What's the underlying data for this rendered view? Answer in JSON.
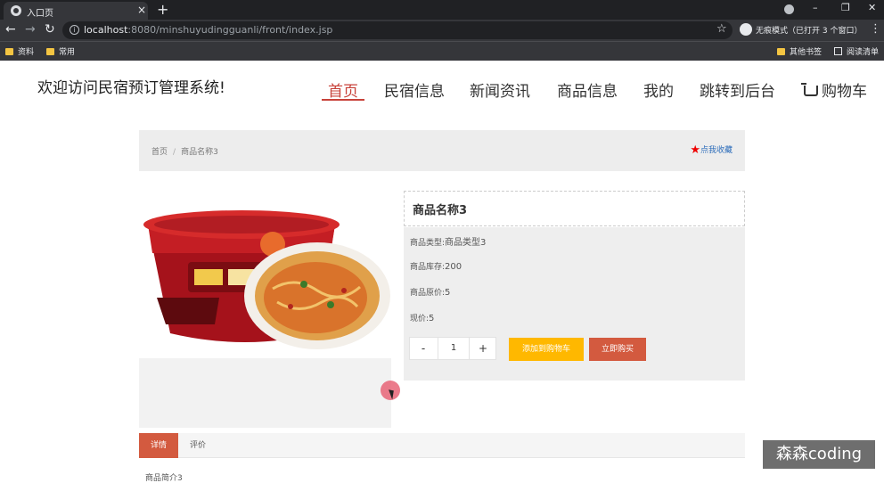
{
  "browser": {
    "tab_title": "入口页",
    "tab_close": "×",
    "new_tab": "+",
    "url_host": "localhost",
    "url_rest": ":8080/minshuyudingguanli/front/index.jsp",
    "incognito_label": "无痕模式（已打开 3 个窗口）",
    "bookmarks": [
      "资料",
      "常用"
    ],
    "bookmarks_right": [
      "其他书签",
      "阅读清单"
    ]
  },
  "site": {
    "title": "欢迎访问民宿预订管理系统!",
    "nav": [
      "首页",
      "民宿信息",
      "新闻资讯",
      "商品信息",
      "我的",
      "跳转到后台",
      "购物车"
    ],
    "active_nav": "首页"
  },
  "breadcrumb": {
    "home": "首页",
    "separator": "/",
    "current": "商品名称3",
    "favorite_label": "点我收藏"
  },
  "product": {
    "name": "商品名称3",
    "type_label": "商品类型:",
    "type_value": "商品类型3",
    "stock_label": "商品库存:",
    "stock_value": "200",
    "orig_price_label": "商品原价:",
    "orig_price_value": "5",
    "price_label": "现价:",
    "price_value": "5",
    "quantity": "1",
    "minus": "-",
    "plus": "+",
    "add_to_cart": "添加到购物车",
    "buy_now": "立即购买"
  },
  "detail_tabs": {
    "details": "详情",
    "reviews": "评价",
    "intro": "商品简介3"
  },
  "watermark": "森森coding",
  "colors": {
    "accent_red": "#c8423a",
    "cart_yellow": "#ffb800",
    "buy_red": "#d35a3f",
    "link_blue": "#2d6dba"
  }
}
